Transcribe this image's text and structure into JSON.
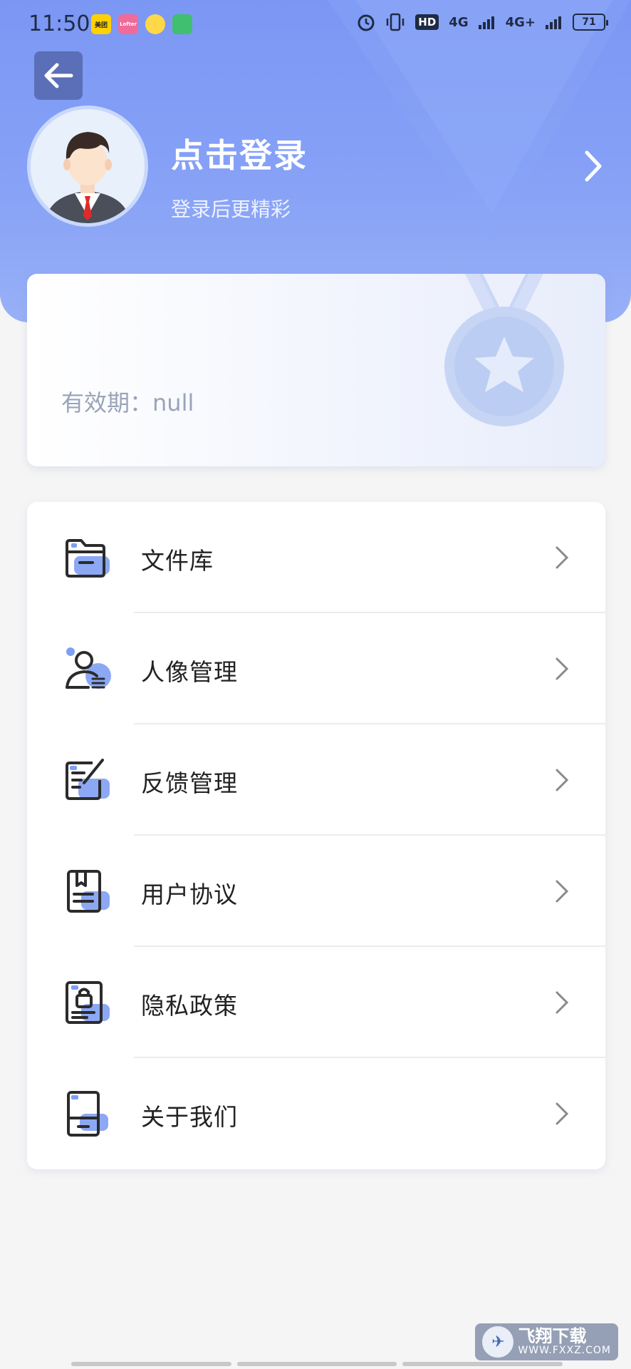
{
  "status_bar": {
    "time": "11:50",
    "apps": [
      "美团",
      "Lofter",
      "QQ音乐",
      "视频"
    ],
    "hd_label": "HD",
    "net_1": "4G",
    "net_2": "4G+",
    "battery": "71"
  },
  "header": {
    "login_title": "点击登录",
    "login_subtitle": "登录后更精彩"
  },
  "vip_card": {
    "validity_label": "有效期：",
    "validity_value": "null"
  },
  "menu": {
    "items": [
      {
        "label": "文件库",
        "icon": "folder-icon"
      },
      {
        "label": "人像管理",
        "icon": "portrait-icon"
      },
      {
        "label": "反馈管理",
        "icon": "feedback-icon"
      },
      {
        "label": "用户协议",
        "icon": "agreement-icon"
      },
      {
        "label": "隐私政策",
        "icon": "privacy-icon"
      },
      {
        "label": "关于我们",
        "icon": "about-icon"
      }
    ]
  },
  "watermark": {
    "title": "飞翔下载",
    "url": "WWW.FXXZ.COM"
  },
  "colors": {
    "header": "#86a1f6",
    "accent": "#6c8ff2",
    "text": "#222222",
    "muted": "#9aa3b8"
  }
}
